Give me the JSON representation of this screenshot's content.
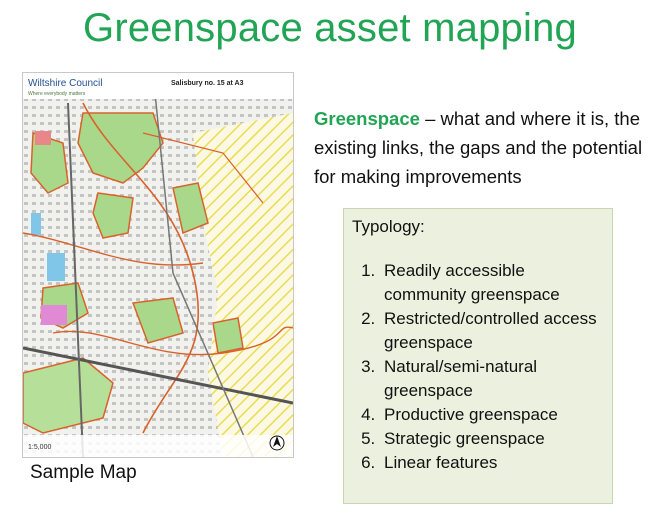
{
  "slide": {
    "title": "Greenspace asset mapping",
    "intro_highlight": "Greenspace",
    "intro_rest": " – what and where it is, the existing links, the gaps and the potential for making improvements",
    "typology_heading": "Typology:",
    "typology_items": [
      "Readily accessible community greenspace",
      "Restricted/controlled access greenspace",
      "Natural/semi-natural greenspace",
      "Productive greenspace",
      "Strategic greenspace",
      "Linear features"
    ],
    "caption": "Sample Map"
  },
  "map": {
    "council_name": "Wiltshire Council",
    "council_tagline": "Where everybody matters",
    "sheet_title": "Salisbury no. 15 at A3",
    "scale": "1:5,000"
  },
  "colors": {
    "title_green": "#22a455",
    "box_bg": "#ebf1de",
    "map_green": "#a9d88a",
    "map_boundary": "#d9622b",
    "map_yellow_hatch": "#f2e25a"
  }
}
